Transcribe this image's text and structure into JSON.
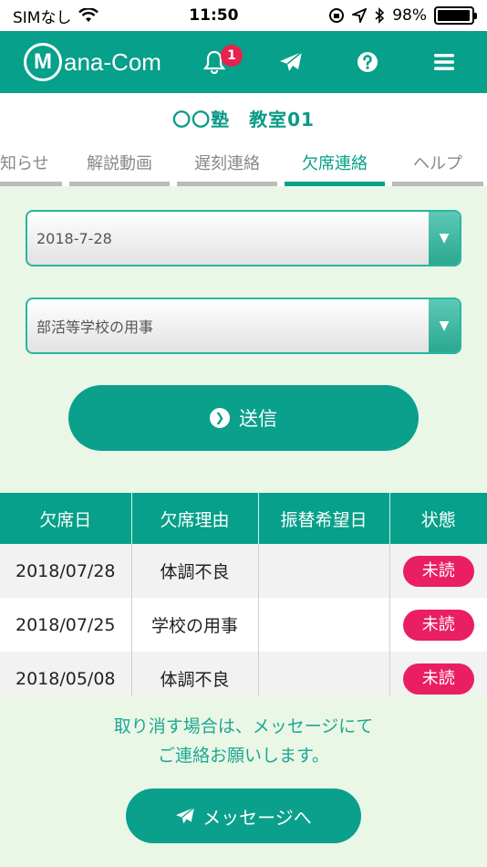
{
  "status_bar": {
    "carrier": "SIMなし",
    "time": "11:50",
    "battery": "98%",
    "battery_level": 0.98
  },
  "header": {
    "logo_initial": "M",
    "logo_text": "ana-Com",
    "notification_count": "1"
  },
  "school": {
    "title": "〇〇塾　教室01"
  },
  "tabs": [
    {
      "label": "お知らせ",
      "display": "知らせ"
    },
    {
      "label": "解説動画"
    },
    {
      "label": "遅刻連絡"
    },
    {
      "label": "欠席連絡",
      "active": true
    },
    {
      "label": "ヘルプ"
    }
  ],
  "form": {
    "date_value": "2018-7-28",
    "reason_value": "部活等学校の用事",
    "send_label": "送信"
  },
  "table": {
    "headers": [
      "欠席日",
      "欠席理由",
      "振替希望日",
      "状態"
    ],
    "rows": [
      {
        "date": "2018/07/28",
        "reason": "体調不良",
        "makeup": "",
        "status": "未読"
      },
      {
        "date": "2018/07/25",
        "reason": "学校の用事",
        "makeup": "",
        "status": "未読"
      },
      {
        "date": "2018/05/08",
        "reason": "体調不良",
        "makeup": "",
        "status": "未読"
      }
    ]
  },
  "note": {
    "line1": "取り消す場合は、メッセージにて",
    "line2": "ご連絡お願いします。"
  },
  "message_button": {
    "label": "メッセージへ"
  },
  "colors": {
    "primary": "#07a08a",
    "accent_red": "#e8214f",
    "background": "#eaf7e6"
  }
}
